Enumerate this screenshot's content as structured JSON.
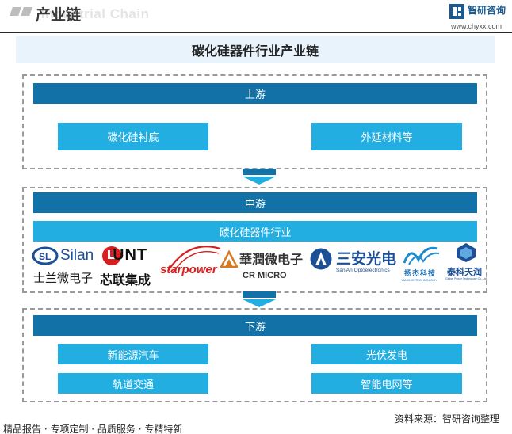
{
  "header": {
    "title": "产业链",
    "ghost_text": "Industrial Chain",
    "logo_name": "智研咨询",
    "logo_url": "www.chyxx.com"
  },
  "main_title": "碳化硅器件行业产业链",
  "upstream": {
    "label": "上游",
    "items": [
      "碳化硅衬底",
      "外延材料等"
    ]
  },
  "midstream": {
    "label": "中游",
    "sub_label": "碳化硅器件行业",
    "companies": {
      "silan_en": "Silan",
      "silan_cn": "士兰微电子",
      "unt_en": "UNT",
      "unt_cn": "芯联集成",
      "starpower": "starpower",
      "crmicro_cn": "華潤微电子",
      "crmicro_en": "CR MICRO",
      "sanan_cn": "三安光电",
      "sanan_en": "San'An Optoelectronics",
      "yangjie_cn": "扬杰科技",
      "yangjie_en": "YANGJIE TECHNOLOGY",
      "taike_cn": "泰科天润",
      "taike_en": "Global Power Technology Co.,Ltd"
    }
  },
  "downstream": {
    "label": "下游",
    "items": [
      "新能源汽车",
      "光伏发电",
      "轨道交通",
      "智能电网等"
    ]
  },
  "footer": {
    "left": "精品报告 · 专项定制 · 品质服务 · 专精特新",
    "right": "资料来源：智研咨询整理"
  },
  "colors": {
    "dark_bar": "#1272a8",
    "light_bar": "#23aee2",
    "title_bg": "#e9f3fb"
  }
}
